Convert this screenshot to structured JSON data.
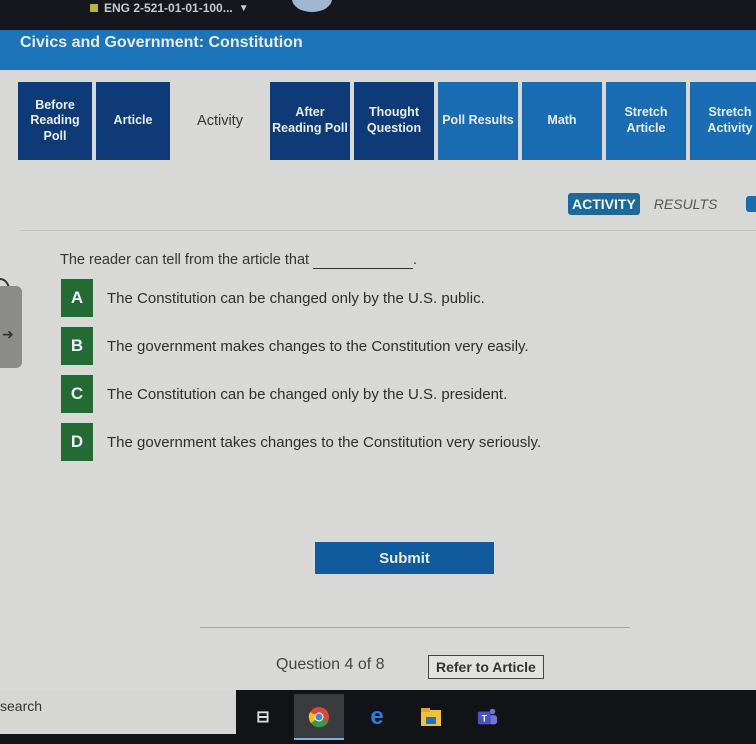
{
  "browser": {
    "tab_title": "ENG 2-521-01-01-100..."
  },
  "header": {
    "title": "Civics and Government: Constitution"
  },
  "tabs": [
    {
      "label": "Before Reading Poll",
      "state": "done"
    },
    {
      "label": "Article",
      "state": "done"
    },
    {
      "label": "Activity",
      "state": "active"
    },
    {
      "label": "After Reading Poll",
      "state": "done"
    },
    {
      "label": "Thought Question",
      "state": "done"
    },
    {
      "label": "Poll Results",
      "state": "pending"
    },
    {
      "label": "Math",
      "state": "pending"
    },
    {
      "label": "Stretch Article",
      "state": "pending"
    },
    {
      "label": "Stretch Activity",
      "state": "pending"
    }
  ],
  "view_toggle": {
    "activity": "ACTIVITY",
    "results": "RESULTS"
  },
  "question": {
    "prompt": "The reader can tell from the article that",
    "end": ".",
    "options": [
      {
        "letter": "A",
        "text": "The Constitution can be changed only by the U.S. public."
      },
      {
        "letter": "B",
        "text": "The government makes changes to the Constitution very easily."
      },
      {
        "letter": "C",
        "text": "The Constitution can be changed only by the U.S. president."
      },
      {
        "letter": "D",
        "text": "The government takes changes to the Constitution very seriously."
      }
    ]
  },
  "submit_label": "Submit",
  "progress": {
    "text": "Question 4 of 8",
    "current": 4,
    "total": 8
  },
  "refer_label": "Refer to Article",
  "taskbar": {
    "search_placeholder": "search",
    "icons": [
      "task-view-icon",
      "chrome-icon",
      "edge-icon",
      "file-explorer-icon",
      "teams-icon"
    ]
  },
  "colors": {
    "accent_dark": "#0f3a78",
    "accent_light": "#1a6cb3",
    "option_green": "#236b33",
    "title_bar": "#1d74b8"
  }
}
